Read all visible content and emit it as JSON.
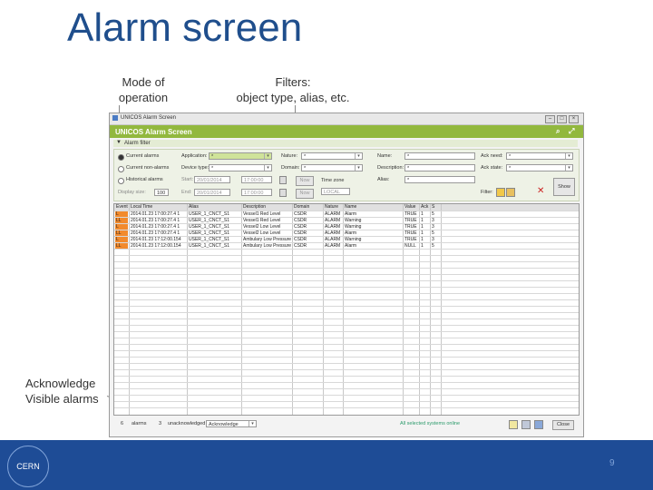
{
  "slide": {
    "title": "Alarm screen",
    "callout_mode": [
      "Mode of",
      "operation"
    ],
    "callout_filters": [
      "Filters:",
      "object type, alias, etc."
    ],
    "callout_ack": [
      "Acknowledge",
      "Visible alarms"
    ],
    "page_number": "9",
    "logo_text": "CERN"
  },
  "window": {
    "titlebar": "UNICOS Alarm Screen",
    "header": "UNICOS Alarm Screen",
    "filter_header": "Alarm filter",
    "modes": [
      "Current alarms",
      "Current non-alarms",
      "Historical alarms"
    ],
    "labels": {
      "app": "Application:",
      "device_type": "Device type:",
      "start": "Start:",
      "end": "End:",
      "nature": "Nature:",
      "domain": "Domain:",
      "time_zone": "Time zone",
      "name": "Name:",
      "description": "Description:",
      "alias": "Alias:",
      "ack_need": "Ack need:",
      "ack_state": "Ack state:",
      "filter": "Filter:",
      "display": "Display size:"
    },
    "values": {
      "app": "*",
      "device_type": "*",
      "start_date": "20/01/2014",
      "start_time": "17:00:00",
      "end_date": "20/01/2014",
      "end_time": "17:00:00",
      "nature": "*",
      "domain": "*",
      "time_zone": "LOCAL",
      "name": "*",
      "description": "*",
      "alias": "*",
      "ack_need": "*",
      "ack_state": "*",
      "display": "100",
      "now1": "Now",
      "now2": "Now"
    },
    "show_button": "Show",
    "columns": [
      "Event",
      "Local Time",
      "Alias",
      "Description",
      "Domain",
      "Nature",
      "Name",
      "Value",
      "Ack",
      "S"
    ],
    "rows": [
      {
        "sev": "#f28a2c",
        "event": "L",
        "time": "2014.01.23 17:00:27.4 1",
        "alias": "USER_1_CNCT_S1",
        "desc": "Vessel1 Red Level",
        "domain": "CSDR",
        "nature": "ALARM",
        "name": "Alarm",
        "value": "TRUE",
        "ack": "1",
        "s": "5"
      },
      {
        "sev": "#f28a2c",
        "event": "LL",
        "time": "2014.01.23 17:00:27.4 1",
        "alias": "USER_1_CNCT_S1",
        "desc": "Vessel1 Red Level",
        "domain": "CSDR",
        "nature": "ALARM",
        "name": "Warning",
        "value": "TRUE",
        "ack": "1",
        "s": "3"
      },
      {
        "sev": "#f28a2c",
        "event": "L",
        "time": "2014.01.23 17:00:27.4 1",
        "alias": "USER_1_CNCT_S1",
        "desc": "Vessel2 Low Level",
        "domain": "CSDR",
        "nature": "ALARM",
        "name": "Warning",
        "value": "TRUE",
        "ack": "1",
        "s": "3"
      },
      {
        "sev": "#f28a2c",
        "event": "LL",
        "time": "2014.01.23 17:00:27.4 1",
        "alias": "USER_1_CNCT_S1",
        "desc": "Vessel2 Low Level",
        "domain": "CSDR",
        "nature": "ALARM",
        "name": "Alarm",
        "value": "TRUE",
        "ack": "1",
        "s": "5"
      },
      {
        "sev": "#f28a2c",
        "event": "L",
        "time": "2014.01.23 17:12:00.154",
        "alias": "USER_1_CNCT_S1",
        "desc": "Ambulary Low Pressure",
        "domain": "CSDR",
        "nature": "ALARM",
        "name": "Warning",
        "value": "TRUE",
        "ack": "1",
        "s": "3"
      },
      {
        "sev": "#f28a2c",
        "event": "LL",
        "time": "2014.01.23 17:12:00.154",
        "alias": "USER_1_CNCT_S1",
        "desc": "Ambulary Low Pressure",
        "domain": "CSDR",
        "nature": "ALARM",
        "name": "Alarm",
        "value": "NULL",
        "ack": "1",
        "s": "5"
      }
    ],
    "status": {
      "alarms_count": "6",
      "alarms_label": "alarms",
      "unack_count": "3",
      "unack_label": "unacknowledged",
      "ack_button": "Acknowledge",
      "link": "All selected systems online",
      "close_button": "Close"
    }
  }
}
